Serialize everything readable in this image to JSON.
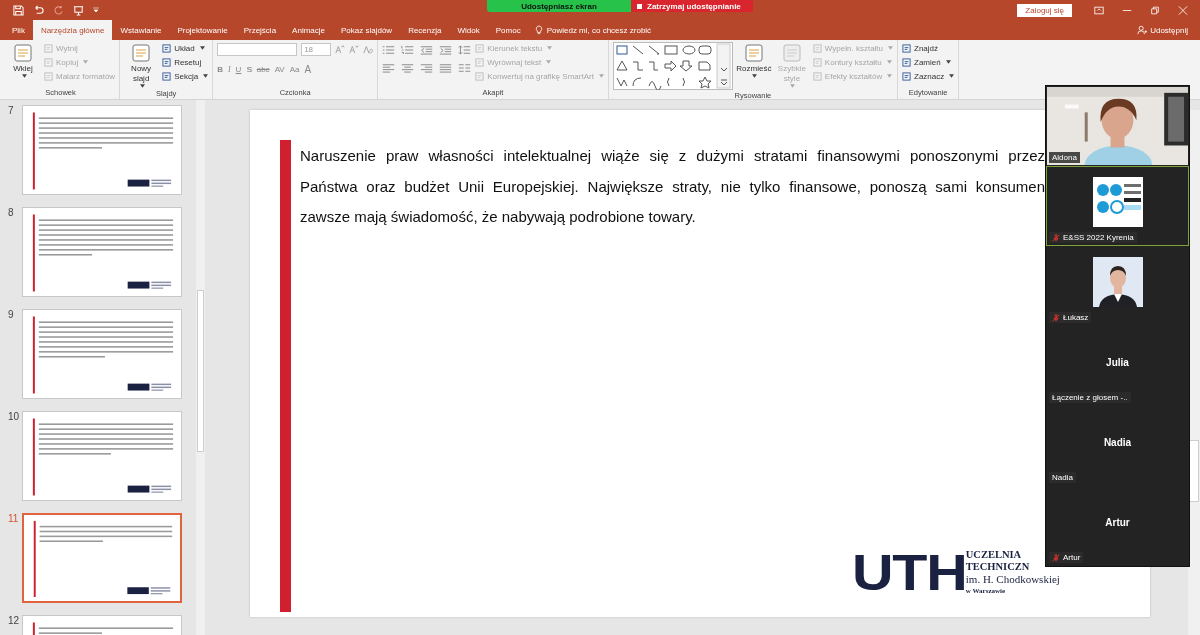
{
  "title_bar": {
    "share_banner": "Udostępniasz ekran",
    "stop_sharing": "Zatrzymaj udostępnianie",
    "sign_in": "Zaloguj się"
  },
  "tabs": [
    {
      "label": "Plik",
      "selected": false
    },
    {
      "label": "Narzędzia główne",
      "selected": true
    },
    {
      "label": "Wstawianie",
      "selected": false
    },
    {
      "label": "Projektowanie",
      "selected": false
    },
    {
      "label": "Przejścia",
      "selected": false
    },
    {
      "label": "Animacje",
      "selected": false
    },
    {
      "label": "Pokaz slajdów",
      "selected": false
    },
    {
      "label": "Recenzja",
      "selected": false
    },
    {
      "label": "Widok",
      "selected": false
    },
    {
      "label": "Pomoc",
      "selected": false
    }
  ],
  "tell_me": "Powiedz mi, co chcesz zrobić",
  "share": "Udostępnij",
  "ribbon": [
    {
      "label": "Schowek",
      "columns": [
        [
          {
            "kind": "large",
            "label": "Wklej",
            "disabled": false,
            "dropdown": true
          }
        ],
        [
          {
            "kind": "small",
            "label": "Wytnij",
            "disabled": true,
            "dropdown": false
          },
          {
            "kind": "small",
            "label": "Kopiuj",
            "disabled": true,
            "dropdown": true
          },
          {
            "kind": "small",
            "label": "Malarz formatów",
            "disabled": true,
            "dropdown": false
          }
        ]
      ]
    },
    {
      "label": "Slajdy",
      "columns": [
        [
          {
            "kind": "large",
            "label": "Nowy slajd",
            "disabled": false,
            "dropdown": true
          }
        ],
        [
          {
            "kind": "small",
            "label": "Układ",
            "disabled": false,
            "dropdown": true
          },
          {
            "kind": "small",
            "label": "Resetuj",
            "disabled": false,
            "dropdown": false
          },
          {
            "kind": "small",
            "label": "Sekcja",
            "disabled": false,
            "dropdown": true
          }
        ]
      ]
    },
    {
      "label": "Czcionka",
      "columns": [
        [
          {
            "kind": "font-row",
            "size": "18"
          },
          {
            "kind": "glyph-row",
            "disabled": true,
            "glyphs": [
              "B",
              "I",
              "U",
              "S",
              "abc",
              "AV",
              "Aa",
              "A"
            ]
          }
        ]
      ]
    },
    {
      "label": "Akapit",
      "columns": [
        [
          {
            "kind": "para-icons"
          }
        ],
        [
          {
            "kind": "small",
            "label": "Kierunek tekstu",
            "disabled": true,
            "dropdown": true
          },
          {
            "kind": "small",
            "label": "Wyrównaj tekst",
            "disabled": true,
            "dropdown": true
          },
          {
            "kind": "small",
            "label": "Konwertuj na grafikę SmartArt",
            "disabled": true,
            "dropdown": true
          }
        ]
      ]
    },
    {
      "label": "Rysowanie",
      "columns": [
        [
          {
            "kind": "shapes"
          }
        ],
        [
          {
            "kind": "large",
            "label": "Rozmieść",
            "disabled": false,
            "dropdown": true
          }
        ],
        [
          {
            "kind": "large",
            "label": "Szybkie style",
            "disabled": true,
            "dropdown": true
          }
        ],
        [
          {
            "kind": "small",
            "label": "Wypełn. kształtu",
            "disabled": true,
            "dropdown": true
          },
          {
            "kind": "small",
            "label": "Kontury kształtu",
            "disabled": true,
            "dropdown": true
          },
          {
            "kind": "small",
            "label": "Efekty kształtów",
            "disabled": true,
            "dropdown": true
          }
        ]
      ]
    },
    {
      "label": "Edytowanie",
      "columns": [
        [
          {
            "kind": "small",
            "label": "Znajdź",
            "disabled": false,
            "dropdown": false
          },
          {
            "kind": "small",
            "label": "Zamień",
            "disabled": false,
            "dropdown": true
          },
          {
            "kind": "small",
            "label": "Zaznacz",
            "disabled": false,
            "dropdown": true
          }
        ]
      ]
    }
  ],
  "thumbnails": [
    {
      "number": "7",
      "selected": false
    },
    {
      "number": "8",
      "selected": false
    },
    {
      "number": "9",
      "selected": false
    },
    {
      "number": "10",
      "selected": false
    },
    {
      "number": "11",
      "selected": true
    },
    {
      "number": "12",
      "selected": false
    }
  ],
  "slide": {
    "lines": [
      "Naruszenie praw własności intelektualnej wiąże się z dużymi stratami finansowymi ponoszonymi przez",
      "Państwa oraz budżet Unii Europejskiej. Największe straty, nie tylko finansowe, ponoszą sami konsumen",
      "zawsze mają świadomość, że nabywają podrobione towary."
    ],
    "logo": {
      "mark": "UTH",
      "lines": [
        "UCZELNIA",
        "TECHNICZN",
        "im. H. Chodkowskiej",
        "w Warszawie"
      ]
    }
  },
  "participants": [
    {
      "name": "Aldona",
      "kind": "video",
      "muted": false,
      "selected": false
    },
    {
      "name": "E&SS 2022 Kyrenia",
      "kind": "logo",
      "muted": true,
      "selected": true
    },
    {
      "name": "Łukasz",
      "muted": true,
      "selected": false
    },
    {
      "name": "Julia",
      "label": "Łączenie z głosem -..",
      "kind": "avatar",
      "muted": false,
      "selected": false
    },
    {
      "name": "Nadia",
      "label": "Nadia",
      "kind": "avatar",
      "muted": false,
      "selected": false
    },
    {
      "name": "Artur",
      "label": "Artur",
      "kind": "avatar",
      "muted": true,
      "selected": false
    }
  ]
}
